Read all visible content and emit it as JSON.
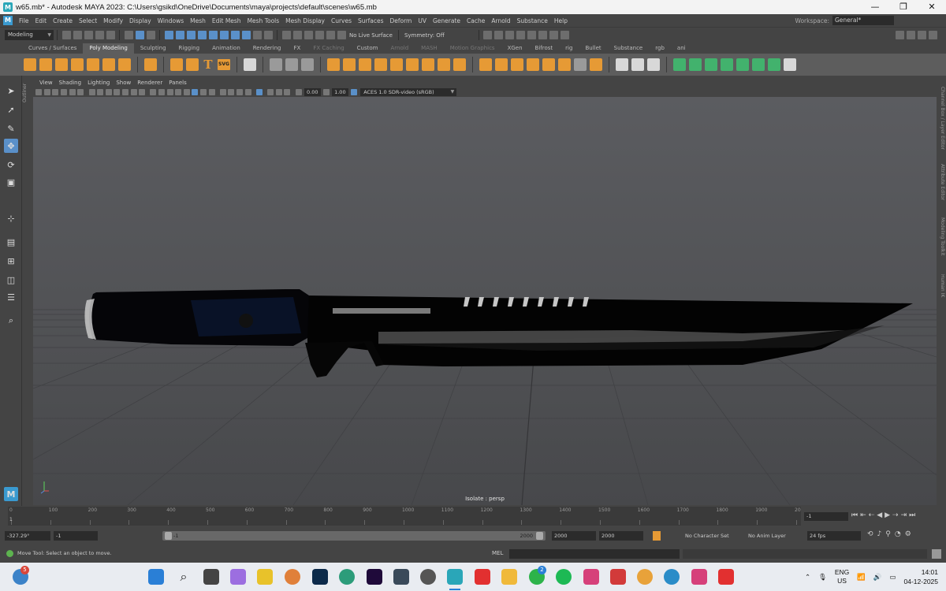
{
  "window": {
    "title": "w65.mb* - Autodesk MAYA 2023: C:\\Users\\gsikd\\OneDrive\\Documents\\maya\\projects\\default\\scenes\\w65.mb",
    "minimize": "—",
    "maximize": "❐",
    "close": "✕"
  },
  "menubar": {
    "items": [
      "File",
      "Edit",
      "Create",
      "Select",
      "Modify",
      "Display",
      "Windows",
      "Mesh",
      "Edit Mesh",
      "Mesh Tools",
      "Mesh Display",
      "Curves",
      "Surfaces",
      "Deform",
      "UV",
      "Generate",
      "Cache",
      "Arnold",
      "Substance",
      "Help"
    ],
    "workspace_label": "Workspace:",
    "workspace_value": "General*"
  },
  "statusline": {
    "menuset": "Modeling",
    "live_surface": "No Live Surface",
    "symmetry": "Symmetry: Off"
  },
  "shelf": {
    "tabs": [
      "Curves / Surfaces",
      "Poly Modeling",
      "Sculpting",
      "Rigging",
      "Animation",
      "Rendering",
      "FX",
      "FX Caching",
      "Custom",
      "Arnold",
      "MASH",
      "Motion Graphics",
      "XGen",
      "Bifrost",
      "rig",
      "Bullet",
      "Substance",
      "rgb",
      "ani"
    ],
    "active_tab": "Poly Modeling",
    "t_glyph": "T",
    "svg_badge": "SVG"
  },
  "outliner_tab": "Outliner",
  "panel": {
    "menus": [
      "View",
      "Shading",
      "Lighting",
      "Show",
      "Renderer",
      "Panels"
    ],
    "exposure": "0.00",
    "gamma": "1.00",
    "color_space": "ACES 1.0 SDR-video (sRGB)"
  },
  "viewport": {
    "isolate_label": "Isolate : persp"
  },
  "right_tabs": [
    "Channel Box / Layer Editor",
    "Attribute Editor",
    "Modeling Toolkit",
    "Human IK"
  ],
  "timeline": {
    "tick_labels": [
      "0",
      "100",
      "200",
      "300",
      "400",
      "500",
      "600",
      "700",
      "800",
      "900",
      "1000",
      "1100",
      "1200",
      "1300",
      "1400",
      "1500",
      "1600",
      "1700",
      "1800",
      "1900",
      "20"
    ],
    "start_marker": "1",
    "current_frame": "-1"
  },
  "range": {
    "rotate_value": "-327.29°",
    "start": "-1",
    "range_lo": "-1",
    "range_hi": "2000",
    "end": "2000",
    "anim_end": "2000",
    "character_set": "No Character Set",
    "anim_layer": "No Anim Layer",
    "fps": "24 fps"
  },
  "command": {
    "help_text": "Move Tool: Select an object to move.",
    "mel_label": "MEL"
  },
  "taskbar": {
    "notification_badge": "5",
    "whatsapp_badge": "2",
    "lang_top": "ENG",
    "lang_bottom": "US",
    "time": "14:01",
    "date": "04-12-2025"
  },
  "colors": {
    "accent": "#5a90c9",
    "shelf_orange": "#e69a35",
    "shelf_green": "#42b26d"
  }
}
